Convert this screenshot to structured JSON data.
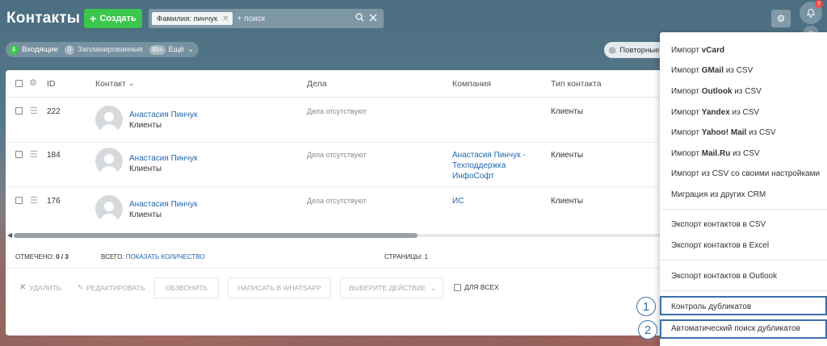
{
  "header": {
    "title": "Контакты",
    "create_label": "Создать",
    "filter_chip": "Фамилия: пинчук",
    "search_placeholder": "+ поиск",
    "notifications_count": "7"
  },
  "subtabs": [
    {
      "count": "4",
      "label": "Входящие"
    },
    {
      "count": "0",
      "label": "Запланированные"
    },
    {
      "count": "99+",
      "label": "Ещё"
    }
  ],
  "duplicates_button": "Повторные",
  "table": {
    "columns": {
      "id": "ID",
      "contact": "Контакт",
      "deals": "Дела",
      "company": "Компания",
      "type": "Тип контакта"
    },
    "rows": [
      {
        "id": "222",
        "name": "Анастасия Пинчук",
        "group": "Клиенты",
        "deals": "Дела отсутствуют",
        "company": "",
        "type": "Клиенты"
      },
      {
        "id": "184",
        "name": "Анастасия Пинчук",
        "group": "Клиенты",
        "deals": "Дела отсутствуют",
        "company_lines": [
          "Анастасия Пинчук -",
          "Техподдержка",
          "ИнфоСофт"
        ],
        "type": "Клиенты"
      },
      {
        "id": "176",
        "name": "Анастасия Пинчук",
        "group": "Клиенты",
        "deals": "Дела отсутствуют",
        "company": "ИС",
        "type": "Клиенты"
      }
    ]
  },
  "footer": {
    "marked_label": "ОТМЕЧЕНО:",
    "marked_value": "0 / 3",
    "total_label": "ВСЕГО:",
    "total_link": "ПОКАЗАТЬ КОЛИЧЕСТВО",
    "pages_label": "СТРАНИЦЫ:",
    "pages_value": "1"
  },
  "actions": {
    "delete": "Удалить",
    "edit": "Редактировать",
    "call": "Обзвонить",
    "whatsapp": "Написать в WhatsApp",
    "choose_action": "Выберите действие",
    "for_all": "Для всех"
  },
  "menu": {
    "import_vcard_pre": "Импорт ",
    "import_vcard_b": "vCard",
    "import_gmail_pre": "Импорт ",
    "import_gmail_b": "GMail",
    "import_gmail_post": " из CSV",
    "import_outlook_pre": "Импорт ",
    "import_outlook_b": "Outlook",
    "import_outlook_post": " из CSV",
    "import_yandex_pre": "Импорт ",
    "import_yandex_b": "Yandex",
    "import_yandex_post": " из CSV",
    "import_yahoo_pre": "Импорт ",
    "import_yahoo_b": "Yahoo! Mail",
    "import_yahoo_post": " из CSV",
    "import_mailru_pre": "Импорт ",
    "import_mailru_b": "Mail.Ru",
    "import_mailru_post": " из CSV",
    "import_csv_custom": "Импорт из CSV со своими настройками",
    "migration": "Миграция из других CRM",
    "export_csv": "Экспорт контактов в CSV",
    "export_excel": "Экспорт контактов в Excel",
    "export_outlook": "Экспорт контактов в Outlook",
    "duplicate_control": "Контроль дубликатов",
    "auto_duplicate_search": "Автоматический поиск дубликатов"
  },
  "callouts": [
    "1",
    "2"
  ],
  "colors": {
    "create": "#3bc74d",
    "link": "#2067b0",
    "highlight": "#3e6ea8",
    "badge": "#f04e4e"
  }
}
